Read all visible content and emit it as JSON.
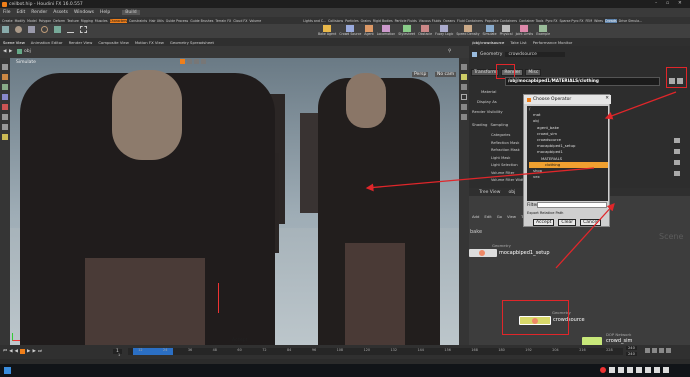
{
  "window": {
    "title": "ceilbot.hip - Houdini FX 16.0.557"
  },
  "menu": [
    "File",
    "Edit",
    "Render",
    "Assets",
    "Windows",
    "Help"
  ],
  "build_label": "Build",
  "shelf_tabs": [
    "Create",
    "Modify",
    "Model",
    "Polygon",
    "Deform",
    "Texture",
    "Rigging",
    "Muscles",
    "Characters",
    "Constraints",
    "Hair Utils",
    "Guide Process",
    "Guide Brushes",
    "Terrain FX",
    "Cloud FX",
    "Volume",
    "Lights and C...",
    "Collisions",
    "Particles",
    "Grains",
    "Rigid Bodies",
    "Particle Fluids",
    "Viscous Fluids",
    "Oceans",
    "Fluid Containers",
    "Populate Containers",
    "Container Tools",
    "Pyro FX",
    "Sparse Pyro FX",
    "FEM",
    "Wires",
    "Crowds",
    "Drive Simula..."
  ],
  "shelf_tools": [
    "Bake Agent",
    "Crowd Source",
    "Agent",
    "Locomotion",
    "Stylesheet",
    "Obstacle",
    "Fuzzy Logic",
    "Speed Density",
    "Simulate",
    "Physical",
    "Joint Limits",
    "Example"
  ],
  "pane_tabs": [
    "Scene View",
    "Animation Editor",
    "Render View",
    "Composite View",
    "Motion FX View",
    "Geometry Spreadsheet"
  ],
  "right_pane_tabs": [
    "/obj/crowdsource",
    "Take List",
    "Performance Monitor"
  ],
  "viewport": {
    "path": "obj",
    "mode_label": "Simulate",
    "persp": "Persp",
    "cam": "No cam",
    "status": "Accept"
  },
  "params": {
    "node_type": "Geometry",
    "node_name": "crowdsource",
    "tabs": [
      "Transform",
      "Render",
      "Misc"
    ],
    "path_value": "/obj/mocapbiped1/MATERIALS/clothing",
    "labels": [
      "Material",
      "Display As",
      "Render Visibility",
      "Shading",
      "Sampling",
      "Categories",
      "Reflection Mask",
      "Refraction Mask",
      "Light Mask",
      "Light Selection",
      "Volume Filter",
      "Volume Filter Width"
    ]
  },
  "chooser": {
    "title": "Choose Operator",
    "tree": [
      "/",
      "mat",
      "obj",
      "agent_bake",
      "crowd_sim",
      "crowdsource",
      "mocapbiped1_setup",
      "mocapbiped1",
      "MATERIALS",
      "clothing",
      "shop",
      "vex"
    ],
    "filter_label": "Filter",
    "export_label": "Export Relative Path",
    "buttons": [
      "Accept",
      "Clear",
      "Cancel"
    ]
  },
  "network": {
    "tabs": [
      "Tree View",
      "obj"
    ],
    "menu": [
      "Add",
      "Edit",
      "Go",
      "View",
      "Tools",
      "Layout",
      "Labs",
      "Help"
    ],
    "scene_label": "Scene",
    "side_label": "bake",
    "nodes": [
      {
        "type": "Geometry",
        "name": "mocapbiped1_setup"
      },
      {
        "type": "Geometry",
        "name": "crowdsource"
      },
      {
        "type": "DOP Network",
        "name": "crowd_sim"
      }
    ]
  },
  "timeline": {
    "current_frame": "1",
    "start": "1",
    "end": "240",
    "end2": "240",
    "ticks": [
      "12",
      "24",
      "36",
      "48",
      "60",
      "72",
      "84",
      "96",
      "108",
      "120",
      "132",
      "144",
      "156",
      "168",
      "180",
      "192",
      "204",
      "216",
      "228"
    ]
  },
  "colors": {
    "accent": "#e0262a",
    "node_yellow": "#d9d96a",
    "node_green": "#c8e87a"
  }
}
